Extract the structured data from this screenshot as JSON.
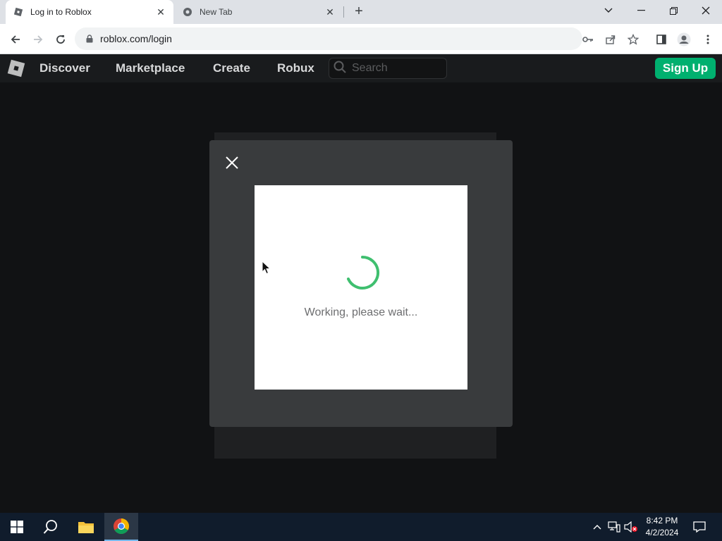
{
  "browser": {
    "tabs": [
      {
        "title": "Log in to Roblox",
        "active": true
      },
      {
        "title": "New Tab",
        "active": false
      }
    ],
    "url": "roblox.com/login"
  },
  "roblox_header": {
    "nav": [
      "Discover",
      "Marketplace",
      "Create",
      "Robux"
    ],
    "search_placeholder": "Search",
    "signup_label": "Sign Up"
  },
  "modal": {
    "status_text": "Working, please wait..."
  },
  "taskbar": {
    "time": "8:42 PM",
    "date": "4/2/2024"
  },
  "colors": {
    "accent_green": "#00b06f",
    "spinner_green": "#3fbf6f",
    "page_bg": "#111214",
    "modal_bg": "#393b3d"
  }
}
